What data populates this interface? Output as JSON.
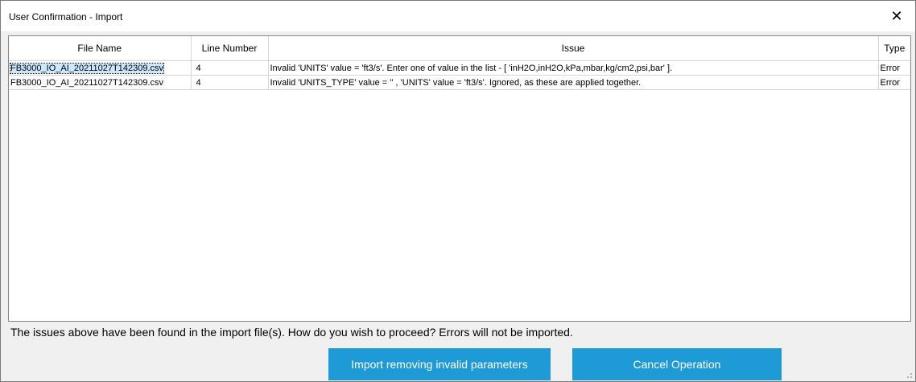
{
  "window": {
    "title": "User Confirmation - Import",
    "close_glyph": "✕"
  },
  "table": {
    "columns": [
      "File Name",
      "Line Number",
      "Issue",
      "Type"
    ],
    "rows": [
      {
        "file_name": "FB3000_IO_AI_20211027T142309.csv",
        "line_number": "4",
        "issue": "Invalid 'UNITS' value = 'ft3/s'. Enter one of value in the list - [ 'inH2O,inH2O,kPa,mbar,kg/cm2,psi,bar' ].",
        "type": "Error"
      },
      {
        "file_name": "FB3000_IO_AI_20211027T142309.csv",
        "line_number": "4",
        "issue": "Invalid 'UNITS_TYPE' value = '' , 'UNITS' value = 'ft3/s'. Ignored, as these are applied together.",
        "type": "Error"
      }
    ]
  },
  "message": "The issues above have been found in the import file(s). How do you wish to proceed? Errors will not be imported.",
  "buttons": {
    "import_label": "Import removing invalid parameters",
    "cancel_label": "Cancel Operation"
  },
  "colors": {
    "button_bg": "#1e9bd7",
    "selection": "#cce8ff"
  },
  "icons": {
    "close": "close-icon",
    "resize": "resize-grip-icon"
  }
}
